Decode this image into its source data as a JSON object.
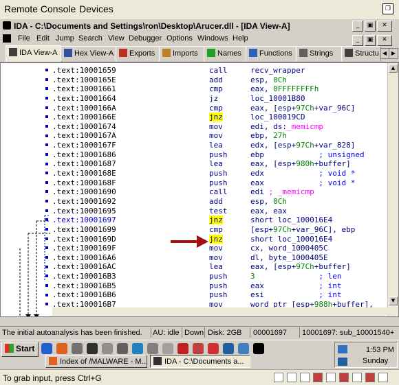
{
  "remote_console": {
    "menu": [
      "Remote Console",
      "Devices"
    ],
    "footer_hint": "To grab input, press Ctrl+G"
  },
  "window": {
    "title": "IDA - C:\\Documents and Settings\\ron\\Desktop\\Arucer.dll - [IDA View-A]",
    "controls": [
      "_",
      "▣",
      "✕"
    ]
  },
  "menubar": [
    "File",
    "Edit",
    "Jump",
    "Search",
    "View",
    "Debugger",
    "Options",
    "Windows",
    "Help"
  ],
  "tabs": [
    {
      "label": "IDA View-A",
      "icon": "ida-view-icon",
      "color": "#404040"
    },
    {
      "label": "Hex View-A",
      "icon": "hex-view-icon",
      "color": "#3050a0"
    },
    {
      "label": "Exports",
      "icon": "exports-icon",
      "color": "#c03020"
    },
    {
      "label": "Imports",
      "icon": "imports-icon",
      "color": "#c08020"
    },
    {
      "label": "Names",
      "icon": "names-icon",
      "color": "#20a020"
    },
    {
      "label": "Functions",
      "icon": "functions-icon",
      "color": "#3060c0"
    },
    {
      "label": "Strings",
      "icon": "strings-icon",
      "color": "#606060"
    },
    {
      "label": "Structu",
      "icon": "structures-icon",
      "color": "#404040"
    }
  ],
  "disasm": [
    {
      "addr": ".text:10001659",
      "mn": "call",
      "op": [
        [
          "recv_wrapper",
          ""
        ]
      ]
    },
    {
      "addr": ".text:1000165E",
      "mn": "add",
      "op": [
        [
          "esp, ",
          ""
        ],
        [
          "0Ch",
          "g"
        ]
      ]
    },
    {
      "addr": ".text:10001661",
      "mn": "cmp",
      "op": [
        [
          "eax, ",
          ""
        ],
        [
          "0FFFFFFFFh",
          "g"
        ]
      ]
    },
    {
      "addr": ".text:10001664",
      "mn": "jz",
      "op": [
        [
          "loc_10001B80",
          ""
        ]
      ]
    },
    {
      "addr": ".text:1000166A",
      "mn": "cmp",
      "op": [
        [
          "eax, [esp+",
          ""
        ],
        [
          "97Ch",
          "g"
        ],
        [
          "+var_96C]",
          ""
        ]
      ]
    },
    {
      "addr": ".text:1000166E",
      "mn": "jnz",
      "jump": true,
      "op": [
        [
          "loc_100019CD",
          ""
        ]
      ]
    },
    {
      "addr": ".text:10001674",
      "mn": "mov",
      "op": [
        [
          "edi, ds:",
          ""
        ],
        [
          "_memicmp",
          "m"
        ]
      ]
    },
    {
      "addr": ".text:1000167A",
      "mn": "mov",
      "op": [
        [
          "ebp, ",
          ""
        ],
        [
          "27h",
          "g"
        ]
      ]
    },
    {
      "addr": ".text:1000167F",
      "mn": "lea",
      "op": [
        [
          "edx, [esp+",
          ""
        ],
        [
          "97Ch",
          "g"
        ],
        [
          "+var_828]",
          ""
        ]
      ]
    },
    {
      "addr": ".text:10001686",
      "mn": "push",
      "op": [
        [
          "ebp",
          ""
        ],
        [
          "            ; unsigned",
          "b"
        ]
      ]
    },
    {
      "addr": ".text:10001687",
      "mn": "lea",
      "op": [
        [
          "eax, [esp+",
          ""
        ],
        [
          "980h",
          "g"
        ],
        [
          "+buffer]",
          ""
        ]
      ]
    },
    {
      "addr": ".text:1000168E",
      "mn": "push",
      "op": [
        [
          "edx",
          ""
        ],
        [
          "            ; void *",
          "b"
        ]
      ]
    },
    {
      "addr": ".text:1000168F",
      "mn": "push",
      "op": [
        [
          "eax",
          ""
        ],
        [
          "            ; void *",
          "b"
        ]
      ]
    },
    {
      "addr": ".text:10001690",
      "mn": "call",
      "op": [
        [
          "edi ",
          ""
        ],
        [
          "; _memicmp",
          "m"
        ]
      ]
    },
    {
      "addr": ".text:10001692",
      "mn": "add",
      "op": [
        [
          "esp, ",
          ""
        ],
        [
          "0Ch",
          "g"
        ]
      ]
    },
    {
      "addr": ".text:10001695",
      "mn": "test",
      "op": [
        [
          "eax, eax",
          ""
        ]
      ]
    },
    {
      "addr": ".text:10001697",
      "mn": "jnz",
      "jump": true,
      "hl": true,
      "op": [
        [
          "short loc_100016E4",
          ""
        ]
      ]
    },
    {
      "addr": ".text:10001699",
      "mn": "cmp",
      "op": [
        [
          "[esp+",
          ""
        ],
        [
          "97Ch",
          "g"
        ],
        [
          "+var_96C], ebp",
          ""
        ]
      ]
    },
    {
      "addr": ".text:1000169D",
      "mn": "jnz",
      "jump": true,
      "op": [
        [
          "short loc_100016E4",
          ""
        ]
      ]
    },
    {
      "addr": ".text:1000169F",
      "mn": "mov",
      "op": [
        [
          "cx, word_1000405C",
          ""
        ]
      ]
    },
    {
      "addr": ".text:100016A6",
      "mn": "mov",
      "op": [
        [
          "dl, byte_1000405E",
          ""
        ]
      ]
    },
    {
      "addr": ".text:100016AC",
      "mn": "lea",
      "op": [
        [
          "eax, [esp+",
          ""
        ],
        [
          "97Ch",
          "g"
        ],
        [
          "+buffer]",
          ""
        ]
      ]
    },
    {
      "addr": ".text:100016B3",
      "mn": "push",
      "op": [
        [
          "3",
          "g"
        ],
        [
          "              ; len",
          "b"
        ]
      ]
    },
    {
      "addr": ".text:100016B5",
      "mn": "push",
      "op": [
        [
          "eax",
          ""
        ],
        [
          "            ; int",
          "b"
        ]
      ]
    },
    {
      "addr": ".text:100016B6",
      "mn": "push",
      "op": [
        [
          "esi",
          ""
        ],
        [
          "            ; int",
          "b"
        ]
      ]
    },
    {
      "addr": ".text:100016B7",
      "mn": "mov",
      "op": [
        [
          "word ptr [esp+",
          ""
        ],
        [
          "988h",
          "g"
        ],
        [
          "+buffer],",
          ""
        ]
      ]
    }
  ],
  "status": {
    "message": "The initial autoanalysis has been finished.",
    "au": "AU:  idle",
    "direction": "Down",
    "disk": "Disk: 2GB",
    "offset": "00001697",
    "location": "10001697: sub_10001540+"
  },
  "taskbar": {
    "start_label": "Start",
    "quicklaunch": [
      {
        "icon": "ie-icon",
        "color": "#2060d0"
      },
      {
        "icon": "firefox-icon",
        "color": "#e06020"
      },
      {
        "icon": "ida-quicklaunch-icon",
        "color": "#707070"
      },
      {
        "icon": "media-icon",
        "color": "#303030"
      },
      {
        "icon": "tool-icon",
        "color": "#909090"
      },
      {
        "icon": "shell-icon",
        "color": "#606060"
      },
      {
        "icon": "explorer-icon",
        "color": "#2080c0"
      },
      {
        "icon": "ftp-icon",
        "color": "#808080"
      },
      {
        "icon": "network-icon",
        "color": "#a0a0a0"
      },
      {
        "icon": "bug-icon",
        "color": "#c02020"
      },
      {
        "icon": "debugger-icon",
        "color": "#c04040"
      },
      {
        "icon": "x-icon",
        "color": "#d03030"
      },
      {
        "icon": "monitor-icon",
        "color": "#2060a0"
      },
      {
        "icon": "regedit-icon",
        "color": "#4080c0"
      },
      {
        "icon": "cmd-icon",
        "color": "#000000"
      }
    ],
    "tasks": [
      {
        "label": "Index of /MALWARE - M...",
        "icon": "firefox-icon",
        "color": "#e06020",
        "active": false
      },
      {
        "label": "IDA - C:\\Documents a...",
        "icon": "ida-icon",
        "color": "#303030",
        "active": true
      }
    ],
    "clock": "1:53 PM",
    "day": "Sunday"
  }
}
